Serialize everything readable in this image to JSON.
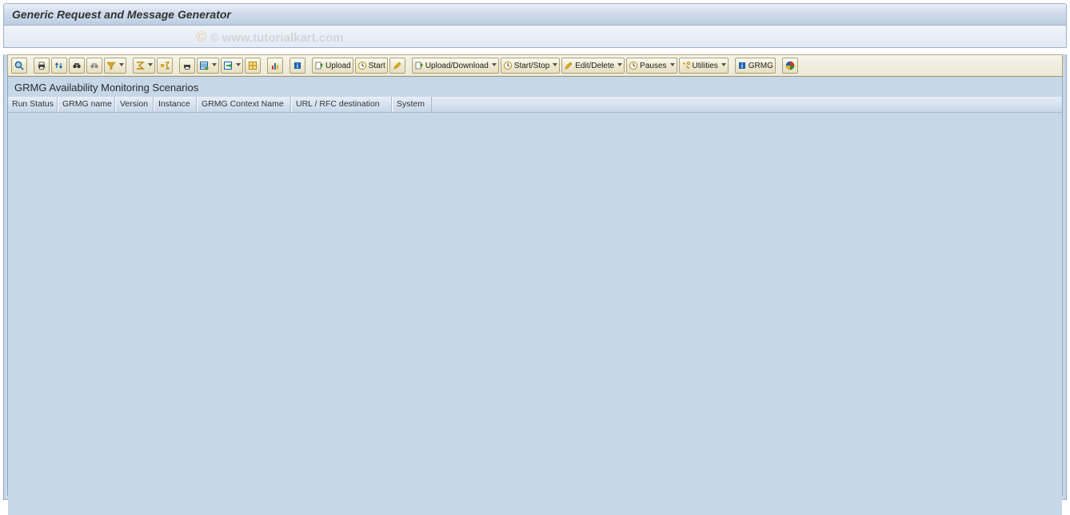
{
  "header": {
    "title": "Generic Request and Message Generator"
  },
  "watermark": "© www.tutorialkart.com",
  "toolbar": {
    "upload_label": "Upload",
    "start_label": "Start",
    "upload_download_label": "Upload/Download",
    "start_stop_label": "Start/Stop",
    "edit_delete_label": "Edit/Delete",
    "pauses_label": "Pauses",
    "utilities_label": "Utilities",
    "grmg_label": "GRMG"
  },
  "main": {
    "subtitle": "GRMG Availability Monitoring Scenarios",
    "columns": [
      "Run Status",
      "GRMG name",
      "Version",
      "Instance",
      "GRMG Context Name",
      "URL / RFC destination",
      "System"
    ]
  }
}
